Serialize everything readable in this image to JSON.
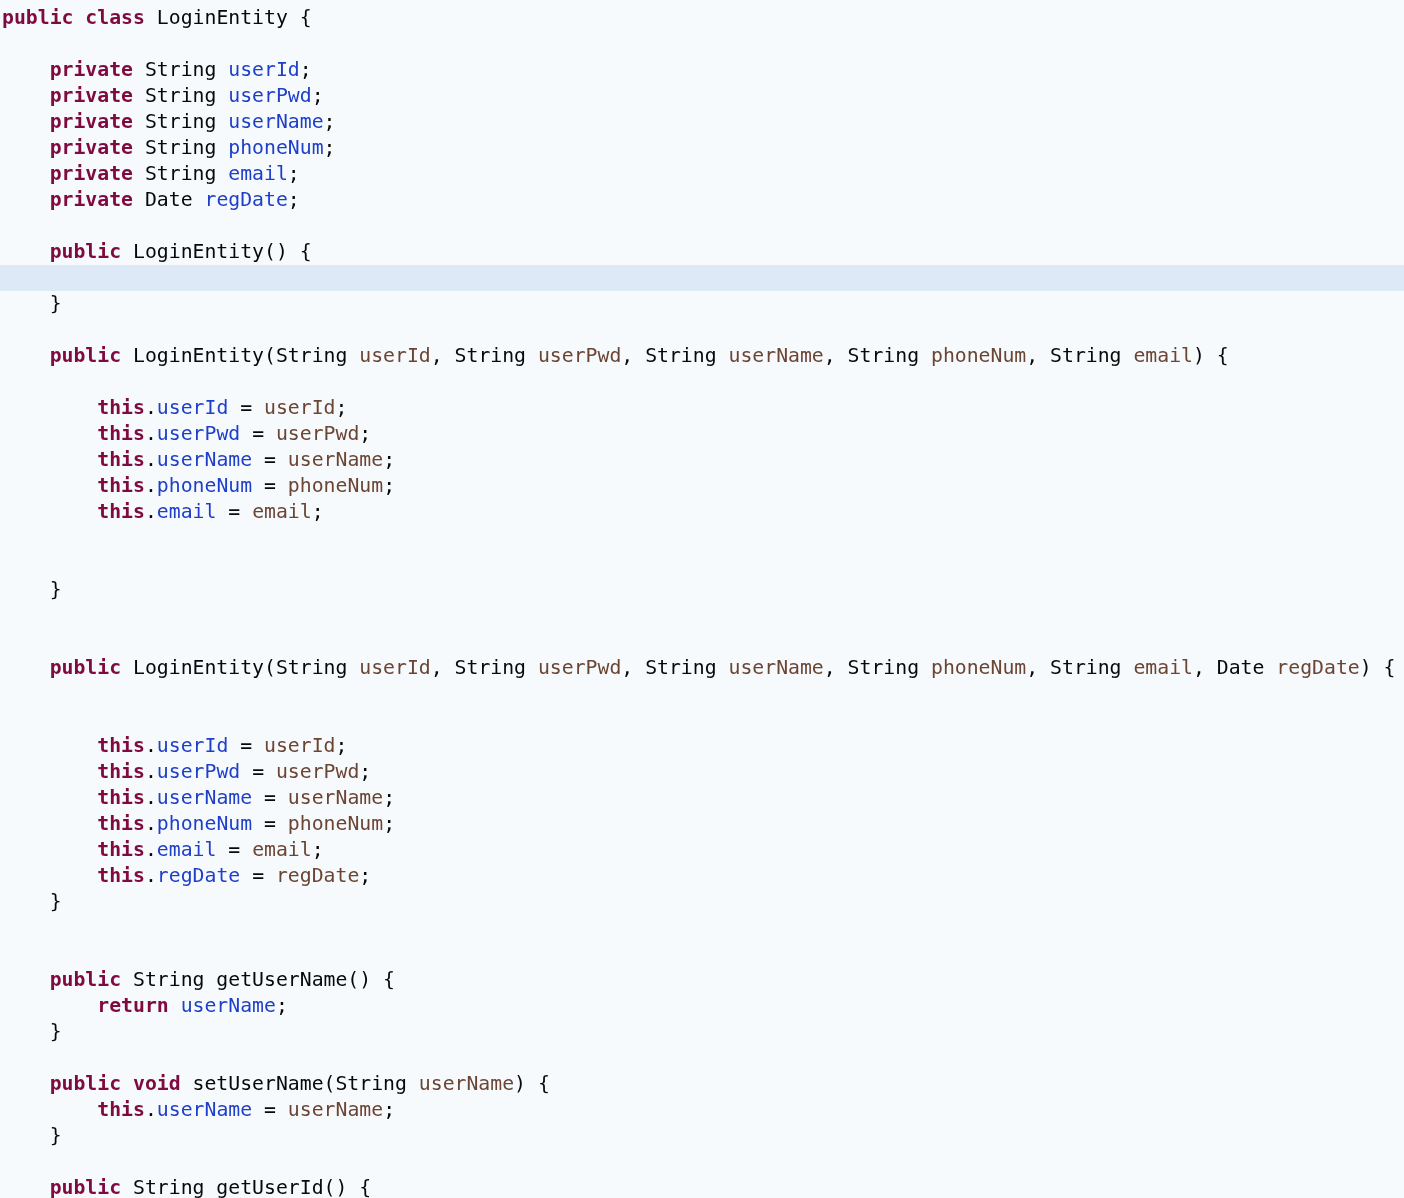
{
  "editor": {
    "lines": [
      {
        "current": false,
        "tokens": [
          {
            "kind": "keyword",
            "text": "public class"
          },
          {
            "kind": "plain",
            "text": " LoginEntity {"
          }
        ]
      },
      {
        "current": false
      },
      {
        "current": false,
        "tokens": [
          {
            "kind": "keyword",
            "text": "    private"
          },
          {
            "kind": "plain",
            "text": " String "
          },
          {
            "kind": "field",
            "text": "userId"
          },
          {
            "kind": "plain",
            "text": ";"
          }
        ]
      },
      {
        "current": false,
        "tokens": [
          {
            "kind": "keyword",
            "text": "    private"
          },
          {
            "kind": "plain",
            "text": " String "
          },
          {
            "kind": "field",
            "text": "userPwd"
          },
          {
            "kind": "plain",
            "text": ";"
          }
        ]
      },
      {
        "current": false,
        "tokens": [
          {
            "kind": "keyword",
            "text": "    private"
          },
          {
            "kind": "plain",
            "text": " String "
          },
          {
            "kind": "field",
            "text": "userName"
          },
          {
            "kind": "plain",
            "text": ";"
          }
        ]
      },
      {
        "current": false,
        "tokens": [
          {
            "kind": "keyword",
            "text": "    private"
          },
          {
            "kind": "plain",
            "text": " String "
          },
          {
            "kind": "field",
            "text": "phoneNum"
          },
          {
            "kind": "plain",
            "text": ";"
          }
        ]
      },
      {
        "current": false,
        "tokens": [
          {
            "kind": "keyword",
            "text": "    private"
          },
          {
            "kind": "plain",
            "text": " String "
          },
          {
            "kind": "field",
            "text": "email"
          },
          {
            "kind": "plain",
            "text": ";"
          }
        ]
      },
      {
        "current": false,
        "tokens": [
          {
            "kind": "keyword",
            "text": "    private"
          },
          {
            "kind": "plain",
            "text": " Date "
          },
          {
            "kind": "field",
            "text": "regDate"
          },
          {
            "kind": "plain",
            "text": ";"
          }
        ]
      },
      {
        "current": false
      },
      {
        "current": false,
        "tokens": [
          {
            "kind": "keyword",
            "text": "    public"
          },
          {
            "kind": "plain",
            "text": " LoginEntity() {"
          }
        ]
      },
      {
        "current": true
      },
      {
        "current": false,
        "tokens": [
          {
            "kind": "plain",
            "text": "    }"
          }
        ]
      },
      {
        "current": false
      },
      {
        "current": false,
        "tokens": [
          {
            "kind": "keyword",
            "text": "    public"
          },
          {
            "kind": "plain",
            "text": " LoginEntity(String "
          },
          {
            "kind": "param",
            "text": "userId"
          },
          {
            "kind": "plain",
            "text": ", String "
          },
          {
            "kind": "param",
            "text": "userPwd"
          },
          {
            "kind": "plain",
            "text": ", String "
          },
          {
            "kind": "param",
            "text": "userName"
          },
          {
            "kind": "plain",
            "text": ", String "
          },
          {
            "kind": "param",
            "text": "phoneNum"
          },
          {
            "kind": "plain",
            "text": ", String "
          },
          {
            "kind": "param",
            "text": "email"
          },
          {
            "kind": "plain",
            "text": ") {"
          }
        ]
      },
      {
        "current": false
      },
      {
        "current": false,
        "tokens": [
          {
            "kind": "keyword",
            "text": "        this"
          },
          {
            "kind": "plain",
            "text": "."
          },
          {
            "kind": "field",
            "text": "userId"
          },
          {
            "kind": "plain",
            "text": " = "
          },
          {
            "kind": "param",
            "text": "userId"
          },
          {
            "kind": "plain",
            "text": ";"
          }
        ]
      },
      {
        "current": false,
        "tokens": [
          {
            "kind": "keyword",
            "text": "        this"
          },
          {
            "kind": "plain",
            "text": "."
          },
          {
            "kind": "field",
            "text": "userPwd"
          },
          {
            "kind": "plain",
            "text": " = "
          },
          {
            "kind": "param",
            "text": "userPwd"
          },
          {
            "kind": "plain",
            "text": ";"
          }
        ]
      },
      {
        "current": false,
        "tokens": [
          {
            "kind": "keyword",
            "text": "        this"
          },
          {
            "kind": "plain",
            "text": "."
          },
          {
            "kind": "field",
            "text": "userName"
          },
          {
            "kind": "plain",
            "text": " = "
          },
          {
            "kind": "param",
            "text": "userName"
          },
          {
            "kind": "plain",
            "text": ";"
          }
        ]
      },
      {
        "current": false,
        "tokens": [
          {
            "kind": "keyword",
            "text": "        this"
          },
          {
            "kind": "plain",
            "text": "."
          },
          {
            "kind": "field",
            "text": "phoneNum"
          },
          {
            "kind": "plain",
            "text": " = "
          },
          {
            "kind": "param",
            "text": "phoneNum"
          },
          {
            "kind": "plain",
            "text": ";"
          }
        ]
      },
      {
        "current": false,
        "tokens": [
          {
            "kind": "keyword",
            "text": "        this"
          },
          {
            "kind": "plain",
            "text": "."
          },
          {
            "kind": "field",
            "text": "email"
          },
          {
            "kind": "plain",
            "text": " = "
          },
          {
            "kind": "param",
            "text": "email"
          },
          {
            "kind": "plain",
            "text": ";"
          }
        ]
      },
      {
        "current": false
      },
      {
        "current": false
      },
      {
        "current": false,
        "tokens": [
          {
            "kind": "plain",
            "text": "    }"
          }
        ]
      },
      {
        "current": false
      },
      {
        "current": false
      },
      {
        "current": false,
        "tokens": [
          {
            "kind": "keyword",
            "text": "    public"
          },
          {
            "kind": "plain",
            "text": " LoginEntity(String "
          },
          {
            "kind": "param",
            "text": "userId"
          },
          {
            "kind": "plain",
            "text": ", String "
          },
          {
            "kind": "param",
            "text": "userPwd"
          },
          {
            "kind": "plain",
            "text": ", String "
          },
          {
            "kind": "param",
            "text": "userName"
          },
          {
            "kind": "plain",
            "text": ", String "
          },
          {
            "kind": "param",
            "text": "phoneNum"
          },
          {
            "kind": "plain",
            "text": ", String "
          },
          {
            "kind": "param",
            "text": "email"
          },
          {
            "kind": "plain",
            "text": ", Date "
          },
          {
            "kind": "param",
            "text": "regDate"
          },
          {
            "kind": "plain",
            "text": ") {"
          }
        ]
      },
      {
        "current": false
      },
      {
        "current": false
      },
      {
        "current": false,
        "tokens": [
          {
            "kind": "keyword",
            "text": "        this"
          },
          {
            "kind": "plain",
            "text": "."
          },
          {
            "kind": "field",
            "text": "userId"
          },
          {
            "kind": "plain",
            "text": " = "
          },
          {
            "kind": "param",
            "text": "userId"
          },
          {
            "kind": "plain",
            "text": ";"
          }
        ]
      },
      {
        "current": false,
        "tokens": [
          {
            "kind": "keyword",
            "text": "        this"
          },
          {
            "kind": "plain",
            "text": "."
          },
          {
            "kind": "field",
            "text": "userPwd"
          },
          {
            "kind": "plain",
            "text": " = "
          },
          {
            "kind": "param",
            "text": "userPwd"
          },
          {
            "kind": "plain",
            "text": ";"
          }
        ]
      },
      {
        "current": false,
        "tokens": [
          {
            "kind": "keyword",
            "text": "        this"
          },
          {
            "kind": "plain",
            "text": "."
          },
          {
            "kind": "field",
            "text": "userName"
          },
          {
            "kind": "plain",
            "text": " = "
          },
          {
            "kind": "param",
            "text": "userName"
          },
          {
            "kind": "plain",
            "text": ";"
          }
        ]
      },
      {
        "current": false,
        "tokens": [
          {
            "kind": "keyword",
            "text": "        this"
          },
          {
            "kind": "plain",
            "text": "."
          },
          {
            "kind": "field",
            "text": "phoneNum"
          },
          {
            "kind": "plain",
            "text": " = "
          },
          {
            "kind": "param",
            "text": "phoneNum"
          },
          {
            "kind": "plain",
            "text": ";"
          }
        ]
      },
      {
        "current": false,
        "tokens": [
          {
            "kind": "keyword",
            "text": "        this"
          },
          {
            "kind": "plain",
            "text": "."
          },
          {
            "kind": "field",
            "text": "email"
          },
          {
            "kind": "plain",
            "text": " = "
          },
          {
            "kind": "param",
            "text": "email"
          },
          {
            "kind": "plain",
            "text": ";"
          }
        ]
      },
      {
        "current": false,
        "tokens": [
          {
            "kind": "keyword",
            "text": "        this"
          },
          {
            "kind": "plain",
            "text": "."
          },
          {
            "kind": "field",
            "text": "regDate"
          },
          {
            "kind": "plain",
            "text": " = "
          },
          {
            "kind": "param",
            "text": "regDate"
          },
          {
            "kind": "plain",
            "text": ";"
          }
        ]
      },
      {
        "current": false,
        "tokens": [
          {
            "kind": "plain",
            "text": "    }"
          }
        ]
      },
      {
        "current": false
      },
      {
        "current": false
      },
      {
        "current": false,
        "tokens": [
          {
            "kind": "keyword",
            "text": "    public"
          },
          {
            "kind": "plain",
            "text": " String getUserName() {"
          }
        ]
      },
      {
        "current": false,
        "tokens": [
          {
            "kind": "keyword",
            "text": "        return "
          },
          {
            "kind": "field",
            "text": "userName"
          },
          {
            "kind": "plain",
            "text": ";"
          }
        ]
      },
      {
        "current": false,
        "tokens": [
          {
            "kind": "plain",
            "text": "    }"
          }
        ]
      },
      {
        "current": false
      },
      {
        "current": false,
        "tokens": [
          {
            "kind": "keyword",
            "text": "    public void"
          },
          {
            "kind": "plain",
            "text": " setUserName(String "
          },
          {
            "kind": "param",
            "text": "userName"
          },
          {
            "kind": "plain",
            "text": ") {"
          }
        ]
      },
      {
        "current": false,
        "tokens": [
          {
            "kind": "keyword",
            "text": "        this"
          },
          {
            "kind": "plain",
            "text": "."
          },
          {
            "kind": "field",
            "text": "userName"
          },
          {
            "kind": "plain",
            "text": " = "
          },
          {
            "kind": "param",
            "text": "userName"
          },
          {
            "kind": "plain",
            "text": ";"
          }
        ]
      },
      {
        "current": false,
        "tokens": [
          {
            "kind": "plain",
            "text": "    }"
          }
        ]
      },
      {
        "current": false
      },
      {
        "current": false,
        "tokens": [
          {
            "kind": "keyword",
            "text": "    public"
          },
          {
            "kind": "plain",
            "text": " String getUserId() {"
          }
        ]
      }
    ]
  }
}
